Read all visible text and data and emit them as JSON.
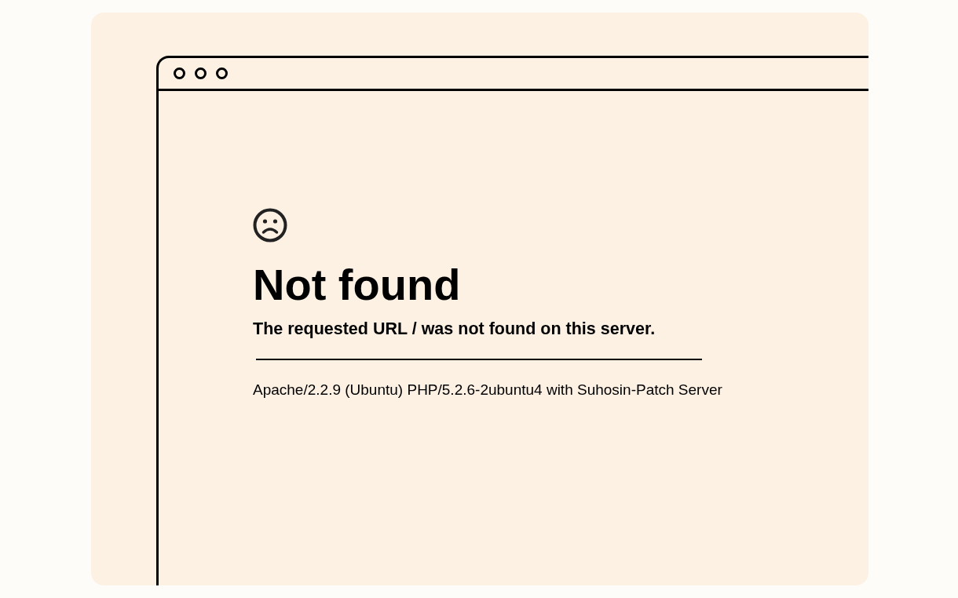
{
  "heading": "Not found",
  "message": "The requested URL / was not found on this server.",
  "server_signature": "Apache/2.2.9 (Ubuntu) PHP/5.2.6-2ubuntu4 with Suhosin-Patch Server"
}
